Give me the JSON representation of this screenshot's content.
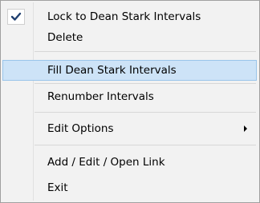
{
  "menu": {
    "items": [
      {
        "label": "Lock to Dean Stark Intervals",
        "checked": true
      },
      {
        "label": "Delete"
      },
      {
        "label": "Fill Dean Stark Intervals",
        "highlighted": true
      },
      {
        "label": "Renumber Intervals"
      },
      {
        "label": "Edit Options",
        "submenu": true
      },
      {
        "label": "Add / Edit / Open Link"
      },
      {
        "label": "Exit"
      }
    ],
    "icons": {
      "check": "checkmark-icon",
      "submenu": "chevron-right-icon"
    },
    "colors": {
      "background": "#f2f2f2",
      "highlight_fill": "#cde3f7",
      "highlight_border": "#99c4ea",
      "border": "#a0a0a0",
      "separator": "#d7d7d7"
    }
  }
}
